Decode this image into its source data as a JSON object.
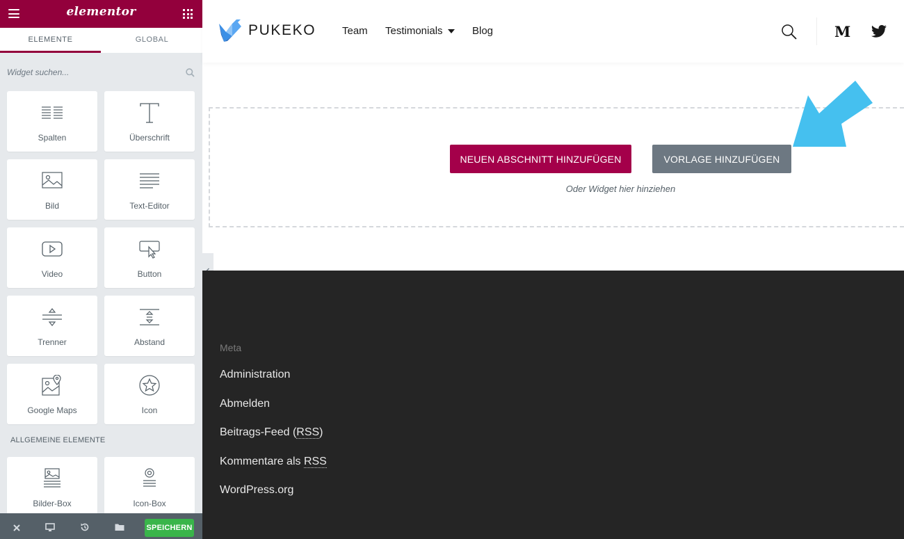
{
  "panel": {
    "logo": "elementor",
    "tabs": [
      "ELEMENTE",
      "GLOBAL"
    ],
    "search": {
      "placeholder": "Widget suchen..."
    },
    "widgets": [
      {
        "label": "Spalten",
        "icon": "columns-icon"
      },
      {
        "label": "Überschrift",
        "icon": "heading-icon"
      },
      {
        "label": "Bild",
        "icon": "image-icon"
      },
      {
        "label": "Text-Editor",
        "icon": "text-editor-icon"
      },
      {
        "label": "Video",
        "icon": "video-icon"
      },
      {
        "label": "Button",
        "icon": "button-icon"
      },
      {
        "label": "Trenner",
        "icon": "divider-icon"
      },
      {
        "label": "Abstand",
        "icon": "spacer-icon"
      },
      {
        "label": "Google Maps",
        "icon": "google-maps-icon"
      },
      {
        "label": "Icon",
        "icon": "star-icon"
      }
    ],
    "section_heading": "ALLGEMEINE ELEMENTE",
    "general_widgets": [
      {
        "label": "Bilder-Box",
        "icon": "image-box-icon"
      },
      {
        "label": "Icon-Box",
        "icon": "icon-box-icon"
      }
    ],
    "footer": {
      "save_label": "SPEICHERN"
    }
  },
  "site": {
    "title": "PUKEKO",
    "nav": {
      "team": "Team",
      "testimonials": "Testimonials",
      "blog": "Blog"
    },
    "medium": "M"
  },
  "editor": {
    "add_section": "NEUEN ABSCHNITT HINZUFÜGEN",
    "add_template": "VORLAGE HINZUFÜGEN",
    "hint": "Oder Widget hier hinziehen"
  },
  "footer": {
    "heading": "Meta",
    "links": {
      "admin": "Administration",
      "logout": "Abmelden",
      "feed_prefix": "Beitrags-Feed (",
      "rss": "RSS",
      "feed_suffix": ")",
      "comments_prefix": "Kommentare als ",
      "wordpress": "WordPress.org"
    }
  },
  "colors": {
    "brand": "#93003c",
    "add_section_button": "#a4004a",
    "template_button": "#6d7882",
    "save_button": "#39b54a",
    "arrow": "#45c0ef",
    "footer_bg": "#252525"
  }
}
